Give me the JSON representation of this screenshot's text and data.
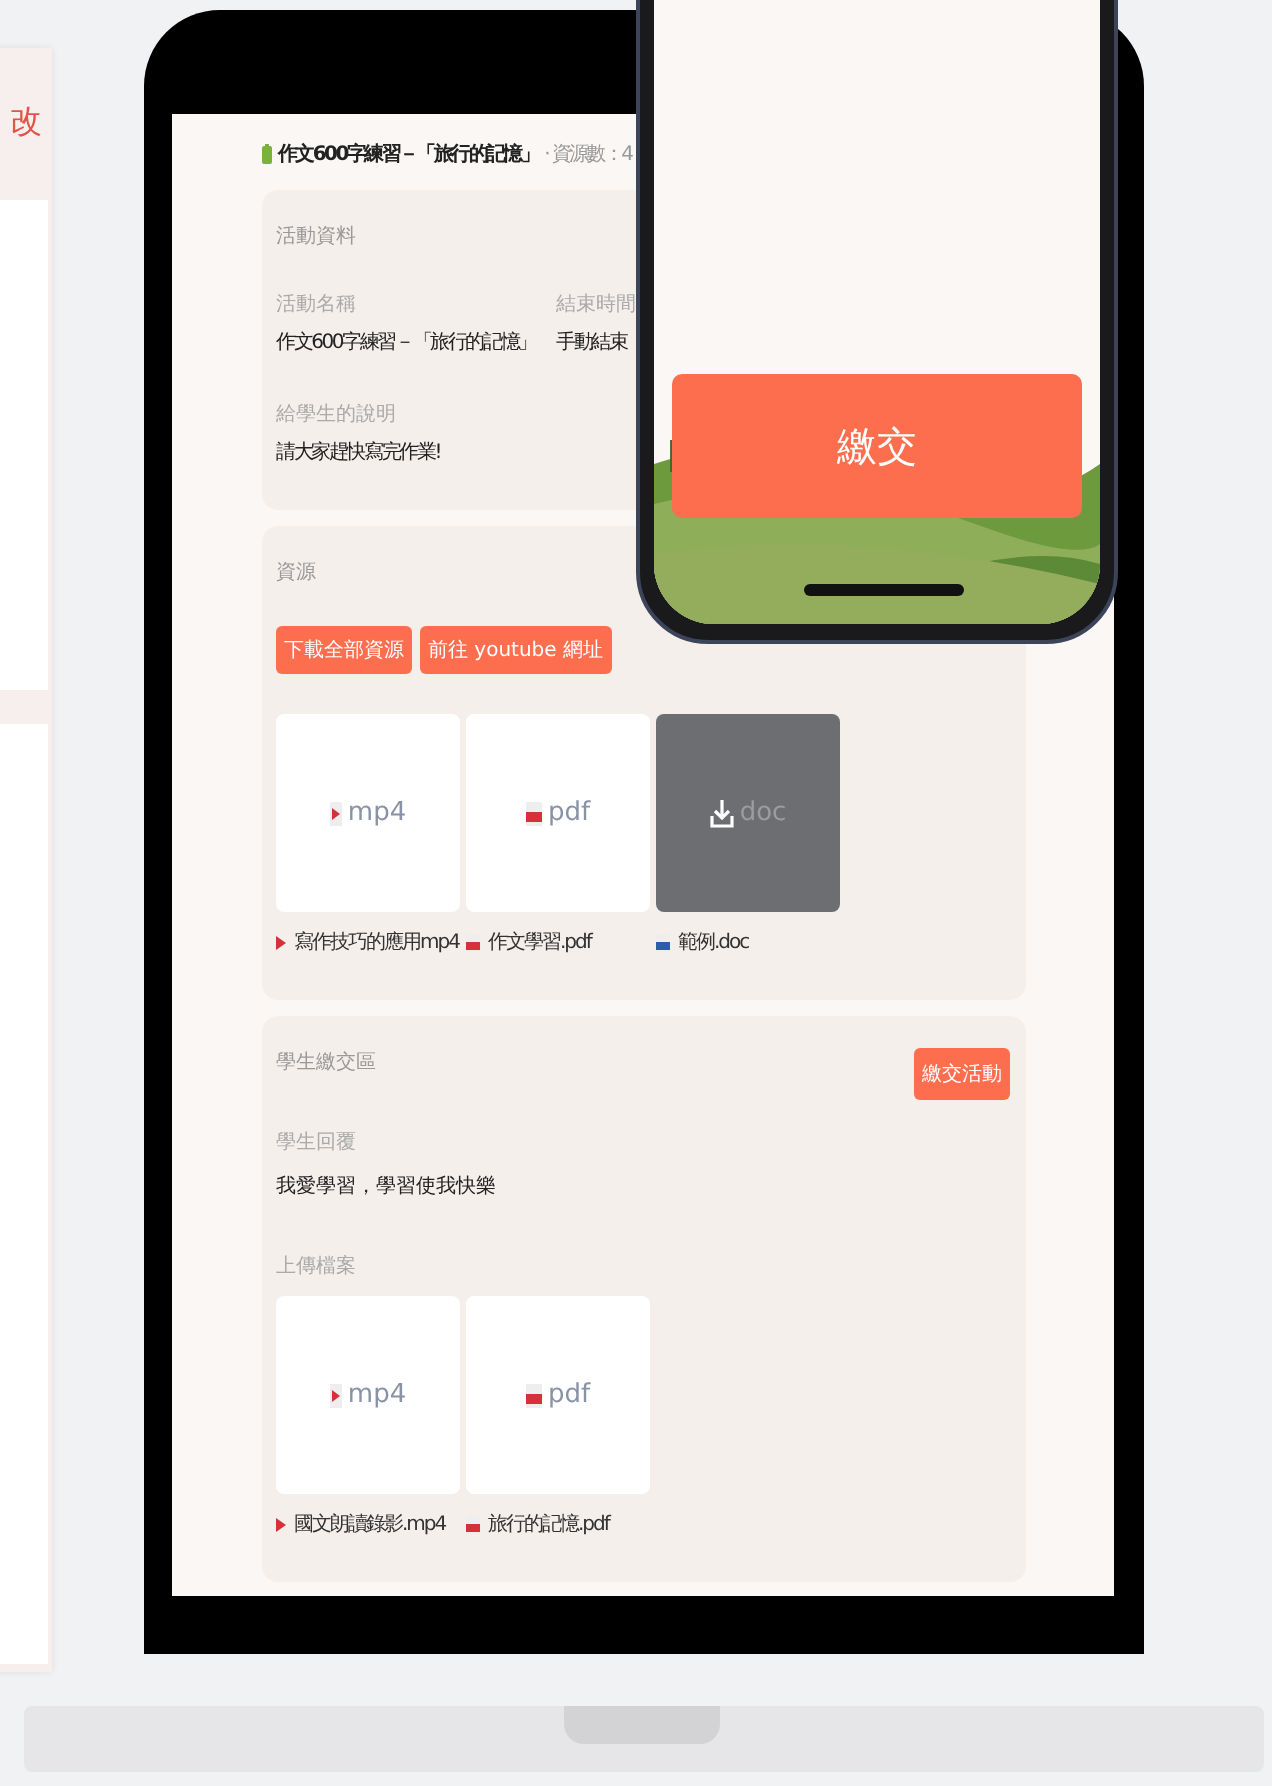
{
  "side_panel": {
    "title": "改"
  },
  "page": {
    "title": "作文600字練習－「旅行的記憶」",
    "resource_count": "· 資源數：4"
  },
  "activity": {
    "heading": "活動資料",
    "fields": [
      {
        "label": "活動名稱",
        "value": "作文600字練習－「旅行的記憶」"
      },
      {
        "label": "結束時間",
        "value": "手動結束"
      },
      {
        "label": "給學生的說明",
        "value": "請大家趕快寫完作業!"
      }
    ]
  },
  "resources": {
    "heading": "資源",
    "buttons": [
      "下載全部資源",
      "前往 youtube 網址"
    ],
    "files": [
      {
        "kind": "video",
        "ext": "mp4",
        "name": "寫作技巧的應用mp4",
        "hovered": false
      },
      {
        "kind": "pdf",
        "ext": "pdf",
        "name": "作文學習.pdf",
        "hovered": false
      },
      {
        "kind": "doc",
        "ext": "doc",
        "name": "範例.doc",
        "hovered": true
      }
    ]
  },
  "submission": {
    "heading": "學生繳交區",
    "button": "繳交活動",
    "reply_label": "學生回覆",
    "reply": "我愛學習，學習使我快樂",
    "upload_label": "上傳檔案",
    "files": [
      {
        "kind": "video",
        "ext": "mp4",
        "name": "國文朗讀錄影.mp4",
        "hovered": false
      },
      {
        "kind": "pdf",
        "ext": "pdf",
        "name": "旅行的記憶.pdf",
        "hovered": false
      }
    ]
  },
  "phone": {
    "submit_button": "繳交"
  }
}
